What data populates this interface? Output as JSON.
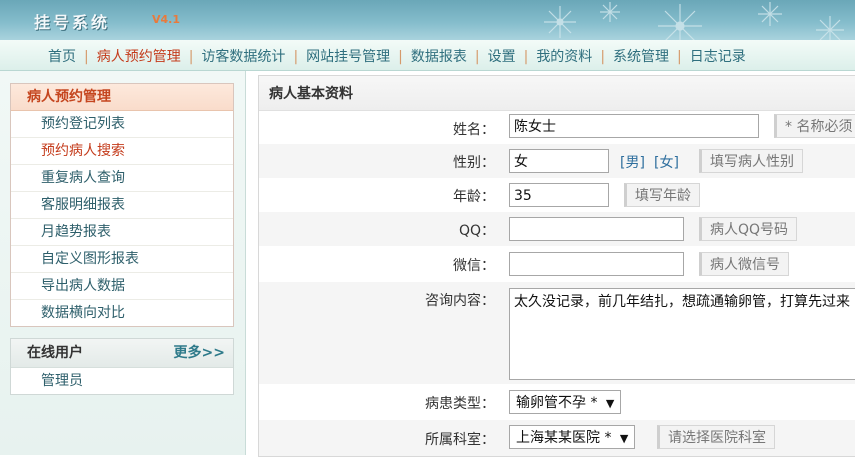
{
  "header": {
    "logo": "挂号系统",
    "version": "V4.1"
  },
  "nav": {
    "items": [
      "首页",
      "病人预约管理",
      "访客数据统计",
      "网站挂号管理",
      "数据报表",
      "设置",
      "我的资料",
      "系统管理",
      "日志记录"
    ],
    "active": "病人预约管理"
  },
  "sidebar": {
    "section_title": "病人预约管理",
    "items": [
      "预约登记列表",
      "预约病人搜索",
      "重复病人查询",
      "客服明细报表",
      "月趋势报表",
      "自定义图形报表",
      "导出病人数据",
      "数据横向对比"
    ],
    "current": "预约病人搜索",
    "online": {
      "title": "在线用户",
      "more": "更多>>",
      "users": [
        "管理员"
      ]
    }
  },
  "form": {
    "title": "病人基本资料",
    "name": {
      "label": "姓名：",
      "value": "陈女士",
      "hint": "* 名称必须"
    },
    "gender": {
      "label": "性别：",
      "value": "女",
      "opt_male": "[男]",
      "opt_female": "[女]",
      "hint": "填写病人性别"
    },
    "age": {
      "label": "年龄：",
      "value": "35",
      "hint": "填写年龄"
    },
    "qq": {
      "label": "QQ：",
      "value": "",
      "hint": "病人QQ号码"
    },
    "wechat": {
      "label": "微信：",
      "value": "",
      "hint": "病人微信号"
    },
    "consult": {
      "label": "咨询内容：",
      "value": "太久没记录，前几年结扎，想疏通输卵管，打算先过来"
    },
    "disease_type": {
      "label": "病患类型：",
      "value": "输卵管不孕 *",
      "arrow": "▼"
    },
    "department": {
      "label": "所属科室：",
      "value": "上海某某医院 *",
      "arrow": "▼",
      "hint": "请选择医院科室"
    }
  }
}
